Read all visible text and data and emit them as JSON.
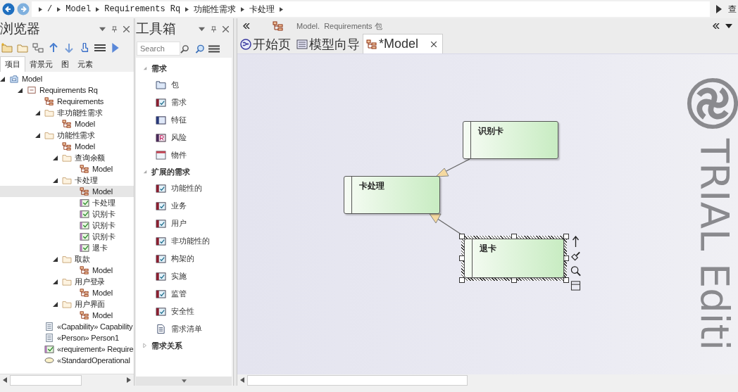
{
  "nav": {
    "path": [
      "/",
      "Model",
      "Requirements Rq",
      "功能性需求",
      "卡处理"
    ],
    "right_label": "查"
  },
  "browser": {
    "title": "浏览器",
    "tabs": [
      {
        "label": "项目",
        "selected": true
      },
      {
        "label": "背景元",
        "selected": false
      },
      {
        "label": "图",
        "selected": false
      },
      {
        "label": "元素",
        "selected": false
      }
    ],
    "tree": [
      {
        "label": "Model",
        "kind": "root",
        "expanded": true,
        "selected": false,
        "children": [
          {
            "label": "Requirements Rq",
            "kind": "view",
            "expanded": true,
            "selected": false,
            "children": [
              {
                "label": "Requirements",
                "kind": "diagram",
                "selected": false
              },
              {
                "label": "非功能性需求",
                "kind": "folder",
                "expanded": true,
                "selected": false,
                "children": [
                  {
                    "label": "Model",
                    "kind": "diagram",
                    "selected": false
                  }
                ]
              },
              {
                "label": "功能性需求",
                "kind": "folder",
                "expanded": true,
                "selected": false,
                "children": [
                  {
                    "label": "Model",
                    "kind": "diagram",
                    "selected": false
                  },
                  {
                    "label": "查询余额",
                    "kind": "folder",
                    "expanded": true,
                    "selected": false,
                    "children": [
                      {
                        "label": "Model",
                        "kind": "diagram",
                        "selected": false
                      }
                    ]
                  },
                  {
                    "label": "卡处理",
                    "kind": "folder",
                    "expanded": true,
                    "selected": false,
                    "children": [
                      {
                        "label": "Model",
                        "kind": "diagram",
                        "selected": true
                      },
                      {
                        "label": "卡处理",
                        "kind": "requirement",
                        "selected": false
                      },
                      {
                        "label": "识别卡",
                        "kind": "requirement",
                        "selected": false
                      },
                      {
                        "label": "识别卡",
                        "kind": "requirement",
                        "selected": false
                      },
                      {
                        "label": "识别卡",
                        "kind": "requirement",
                        "selected": false
                      },
                      {
                        "label": "退卡",
                        "kind": "requirement",
                        "selected": false
                      }
                    ]
                  },
                  {
                    "label": "取款",
                    "kind": "folder",
                    "expanded": true,
                    "selected": false,
                    "children": [
                      {
                        "label": "Model",
                        "kind": "diagram",
                        "selected": false
                      }
                    ]
                  },
                  {
                    "label": "用户登录",
                    "kind": "folder",
                    "expanded": true,
                    "selected": false,
                    "children": [
                      {
                        "label": "Model",
                        "kind": "diagram",
                        "selected": false
                      }
                    ]
                  },
                  {
                    "label": "用户界面",
                    "kind": "folder",
                    "expanded": true,
                    "selected": false,
                    "children": [
                      {
                        "label": "Model",
                        "kind": "diagram",
                        "selected": false
                      }
                    ]
                  }
                ]
              },
              {
                "label": "«Capability» Capability",
                "kind": "class",
                "selected": false
              },
              {
                "label": "«Person» Person1",
                "kind": "class",
                "selected": false
              },
              {
                "label": "«requirement» Require",
                "kind": "requirement",
                "selected": false
              },
              {
                "label": "«StandardOperational",
                "kind": "usecase",
                "selected": false
              }
            ]
          }
        ]
      }
    ]
  },
  "toolbox": {
    "title": "工具箱",
    "search": {
      "placeholder": "Search"
    },
    "groups": [
      {
        "label": "需求",
        "expanded": true,
        "items": [
          {
            "label": "包",
            "kind": "package"
          },
          {
            "label": "需求",
            "kind": "requirement"
          },
          {
            "label": "特征",
            "kind": "feature"
          },
          {
            "label": "风险",
            "kind": "risk"
          },
          {
            "label": "物件",
            "kind": "artifact"
          }
        ]
      },
      {
        "label": "扩展的需求",
        "expanded": true,
        "items": [
          {
            "label": "功能性的",
            "kind": "requirement"
          },
          {
            "label": "业务",
            "kind": "requirement"
          },
          {
            "label": "用户",
            "kind": "requirement"
          },
          {
            "label": "非功能性的",
            "kind": "requirement"
          },
          {
            "label": "构架的",
            "kind": "requirement"
          },
          {
            "label": "实施",
            "kind": "requirement"
          },
          {
            "label": "监管",
            "kind": "requirement"
          },
          {
            "label": "安全性",
            "kind": "requirement"
          },
          {
            "label": "需求清单",
            "kind": "document"
          }
        ]
      },
      {
        "label": "需求关系",
        "expanded": false
      }
    ]
  },
  "diagram": {
    "breadcrumb": "Model.  Requirements 包",
    "tabs": [
      {
        "label": "开始页",
        "kind": "start",
        "selected": false
      },
      {
        "label": "模型向导",
        "kind": "wizard",
        "selected": false
      },
      {
        "label": "*Model",
        "kind": "diagram",
        "selected": true
      }
    ],
    "nodes": [
      {
        "label": "识别卡",
        "selected": false
      },
      {
        "label": "卡处理",
        "selected": false
      },
      {
        "label": "退卡",
        "selected": true
      }
    ],
    "watermark": "TRIAL Editi"
  }
}
